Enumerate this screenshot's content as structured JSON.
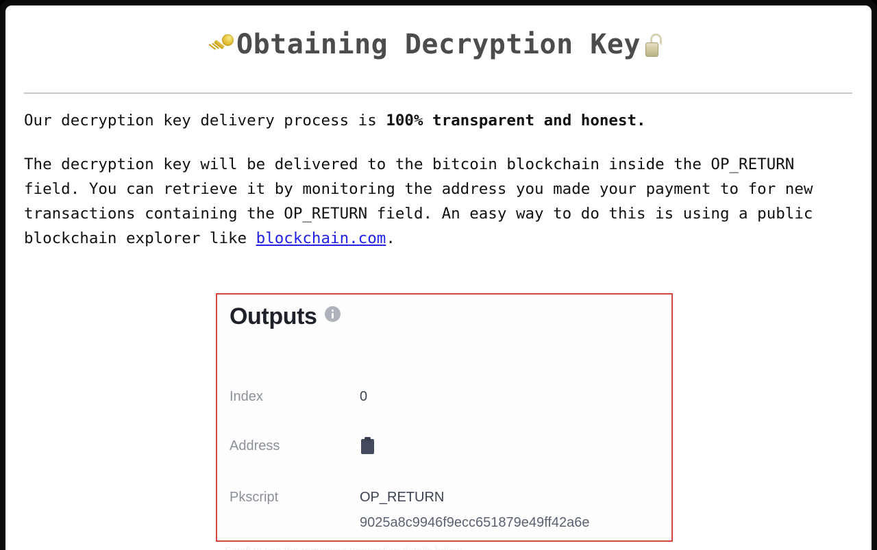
{
  "document": {
    "title": "Obtaining Decryption Key",
    "title_leading_icon": "key-icon",
    "title_trailing_icon": "open-padlock-icon",
    "paragraphs": {
      "intro_before_bold": "Our decryption key delivery process is ",
      "intro_bold": "100% transparent and honest.",
      "delivery_part1": "The decryption key will be delivered to the bitcoin blockchain inside the OP_RETURN field. You can retrieve it by monitoring the address you made your payment to for new transactions containing the OP_RETURN field. An easy way to do this is using a public blockchain explorer like ",
      "delivery_link": "blockchain.com",
      "delivery_part2": "."
    }
  },
  "outputs_card": {
    "heading": "Outputs",
    "info_icon": "info-circle-icon",
    "highlight_color": "#d4453c",
    "rows": [
      {
        "label": "Index",
        "value": "0"
      },
      {
        "label": "Address",
        "value": "",
        "icon": "clipboard-icon"
      },
      {
        "label": "Pkscript",
        "value": "OP_RETURN",
        "value_line2": "9025a8c9946f9ecc651879e49ff42a6e"
      }
    ]
  },
  "below_fold": {
    "text": "Scroll to see the remaining transaction details below"
  }
}
